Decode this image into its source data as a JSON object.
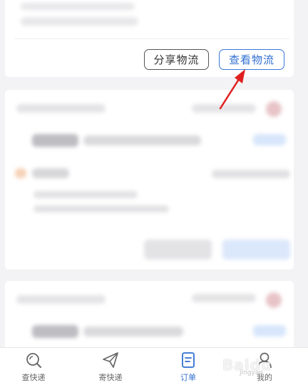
{
  "order_card": {
    "share_logistics_label": "分享物流",
    "view_logistics_label": "查看物流"
  },
  "tabbar": {
    "items": [
      {
        "label": "查快递",
        "icon": "search-icon",
        "active": false
      },
      {
        "label": "寄快递",
        "icon": "send-icon",
        "active": false
      },
      {
        "label": "订单",
        "icon": "order-icon",
        "active": true
      },
      {
        "label": "我的",
        "icon": "profile-icon",
        "active": false
      }
    ]
  },
  "colors": {
    "accent": "#2f6fd2",
    "annotation_arrow": "#e02020",
    "background": "#f3f3f5"
  },
  "watermark": {
    "text": "Baidu",
    "subtext": "jingyan"
  }
}
